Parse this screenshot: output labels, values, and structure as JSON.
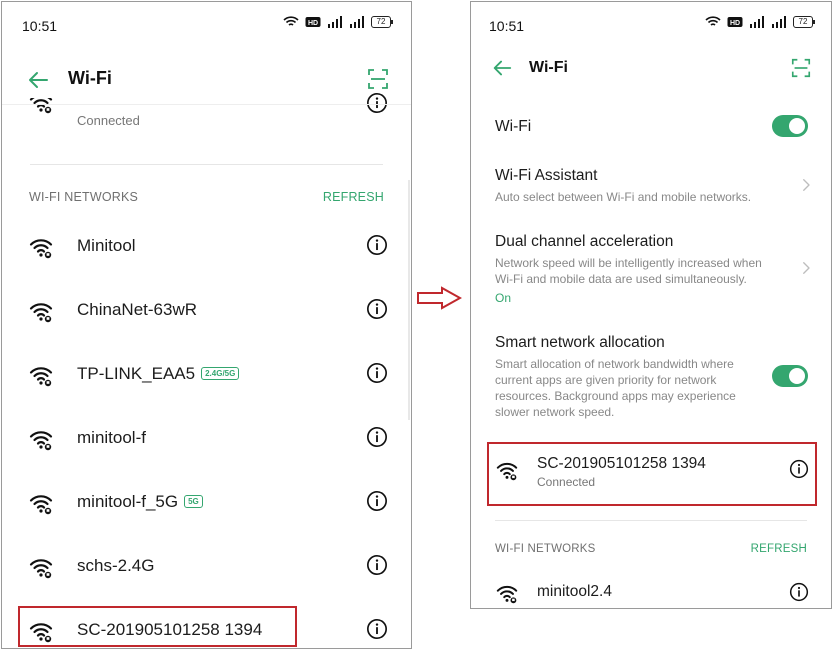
{
  "left": {
    "status": {
      "time": "10:51",
      "battery": "72"
    },
    "title": "Wi-Fi",
    "connected_partial": {
      "status": "Connected"
    },
    "section_header": "WI-FI NETWORKS",
    "refresh": "REFRESH",
    "networks": [
      {
        "ssid": "Minitool",
        "badge": ""
      },
      {
        "ssid": "ChinaNet-63wR",
        "badge": ""
      },
      {
        "ssid": "TP-LINK_EAA5",
        "badge": "2.4G/5G"
      },
      {
        "ssid": "minitool-f",
        "badge": ""
      },
      {
        "ssid": "minitool-f_5G",
        "badge": "5G"
      },
      {
        "ssid": "schs-2.4G",
        "badge": ""
      },
      {
        "ssid": "SC-201905101258 1394",
        "badge": ""
      }
    ]
  },
  "right": {
    "status": {
      "time": "10:51",
      "battery": "72"
    },
    "title": "Wi-Fi",
    "wifi_toggle": {
      "label": "Wi-Fi",
      "on": true
    },
    "wifi_assistant": {
      "title": "Wi-Fi Assistant",
      "subtitle": "Auto select between Wi-Fi and mobile networks."
    },
    "dual_channel": {
      "title": "Dual channel acceleration",
      "subtitle_1": "Network speed will be intelligently increased when",
      "subtitle_2": "Wi-Fi and mobile data are used simultaneously.",
      "state": "On"
    },
    "smart_network": {
      "title": "Smart network allocation",
      "lines": [
        "Smart allocation of network bandwidth where",
        "current apps are given priority for network",
        "resources. Background apps may experience",
        "slower network speed."
      ],
      "on": true
    },
    "connected_network": {
      "ssid": "SC-201905101258 1394",
      "status": "Connected"
    },
    "section_header": "WI-FI NETWORKS",
    "refresh": "REFRESH",
    "networks": [
      {
        "ssid": "minitool2.4"
      }
    ]
  },
  "colors": {
    "accent": "#34a66f",
    "highlight": "#c0282d"
  },
  "icons": [
    "back-arrow-icon",
    "scan-icon",
    "wifi-icon",
    "info-icon",
    "chevron-right-icon",
    "arrow-right-icon"
  ]
}
